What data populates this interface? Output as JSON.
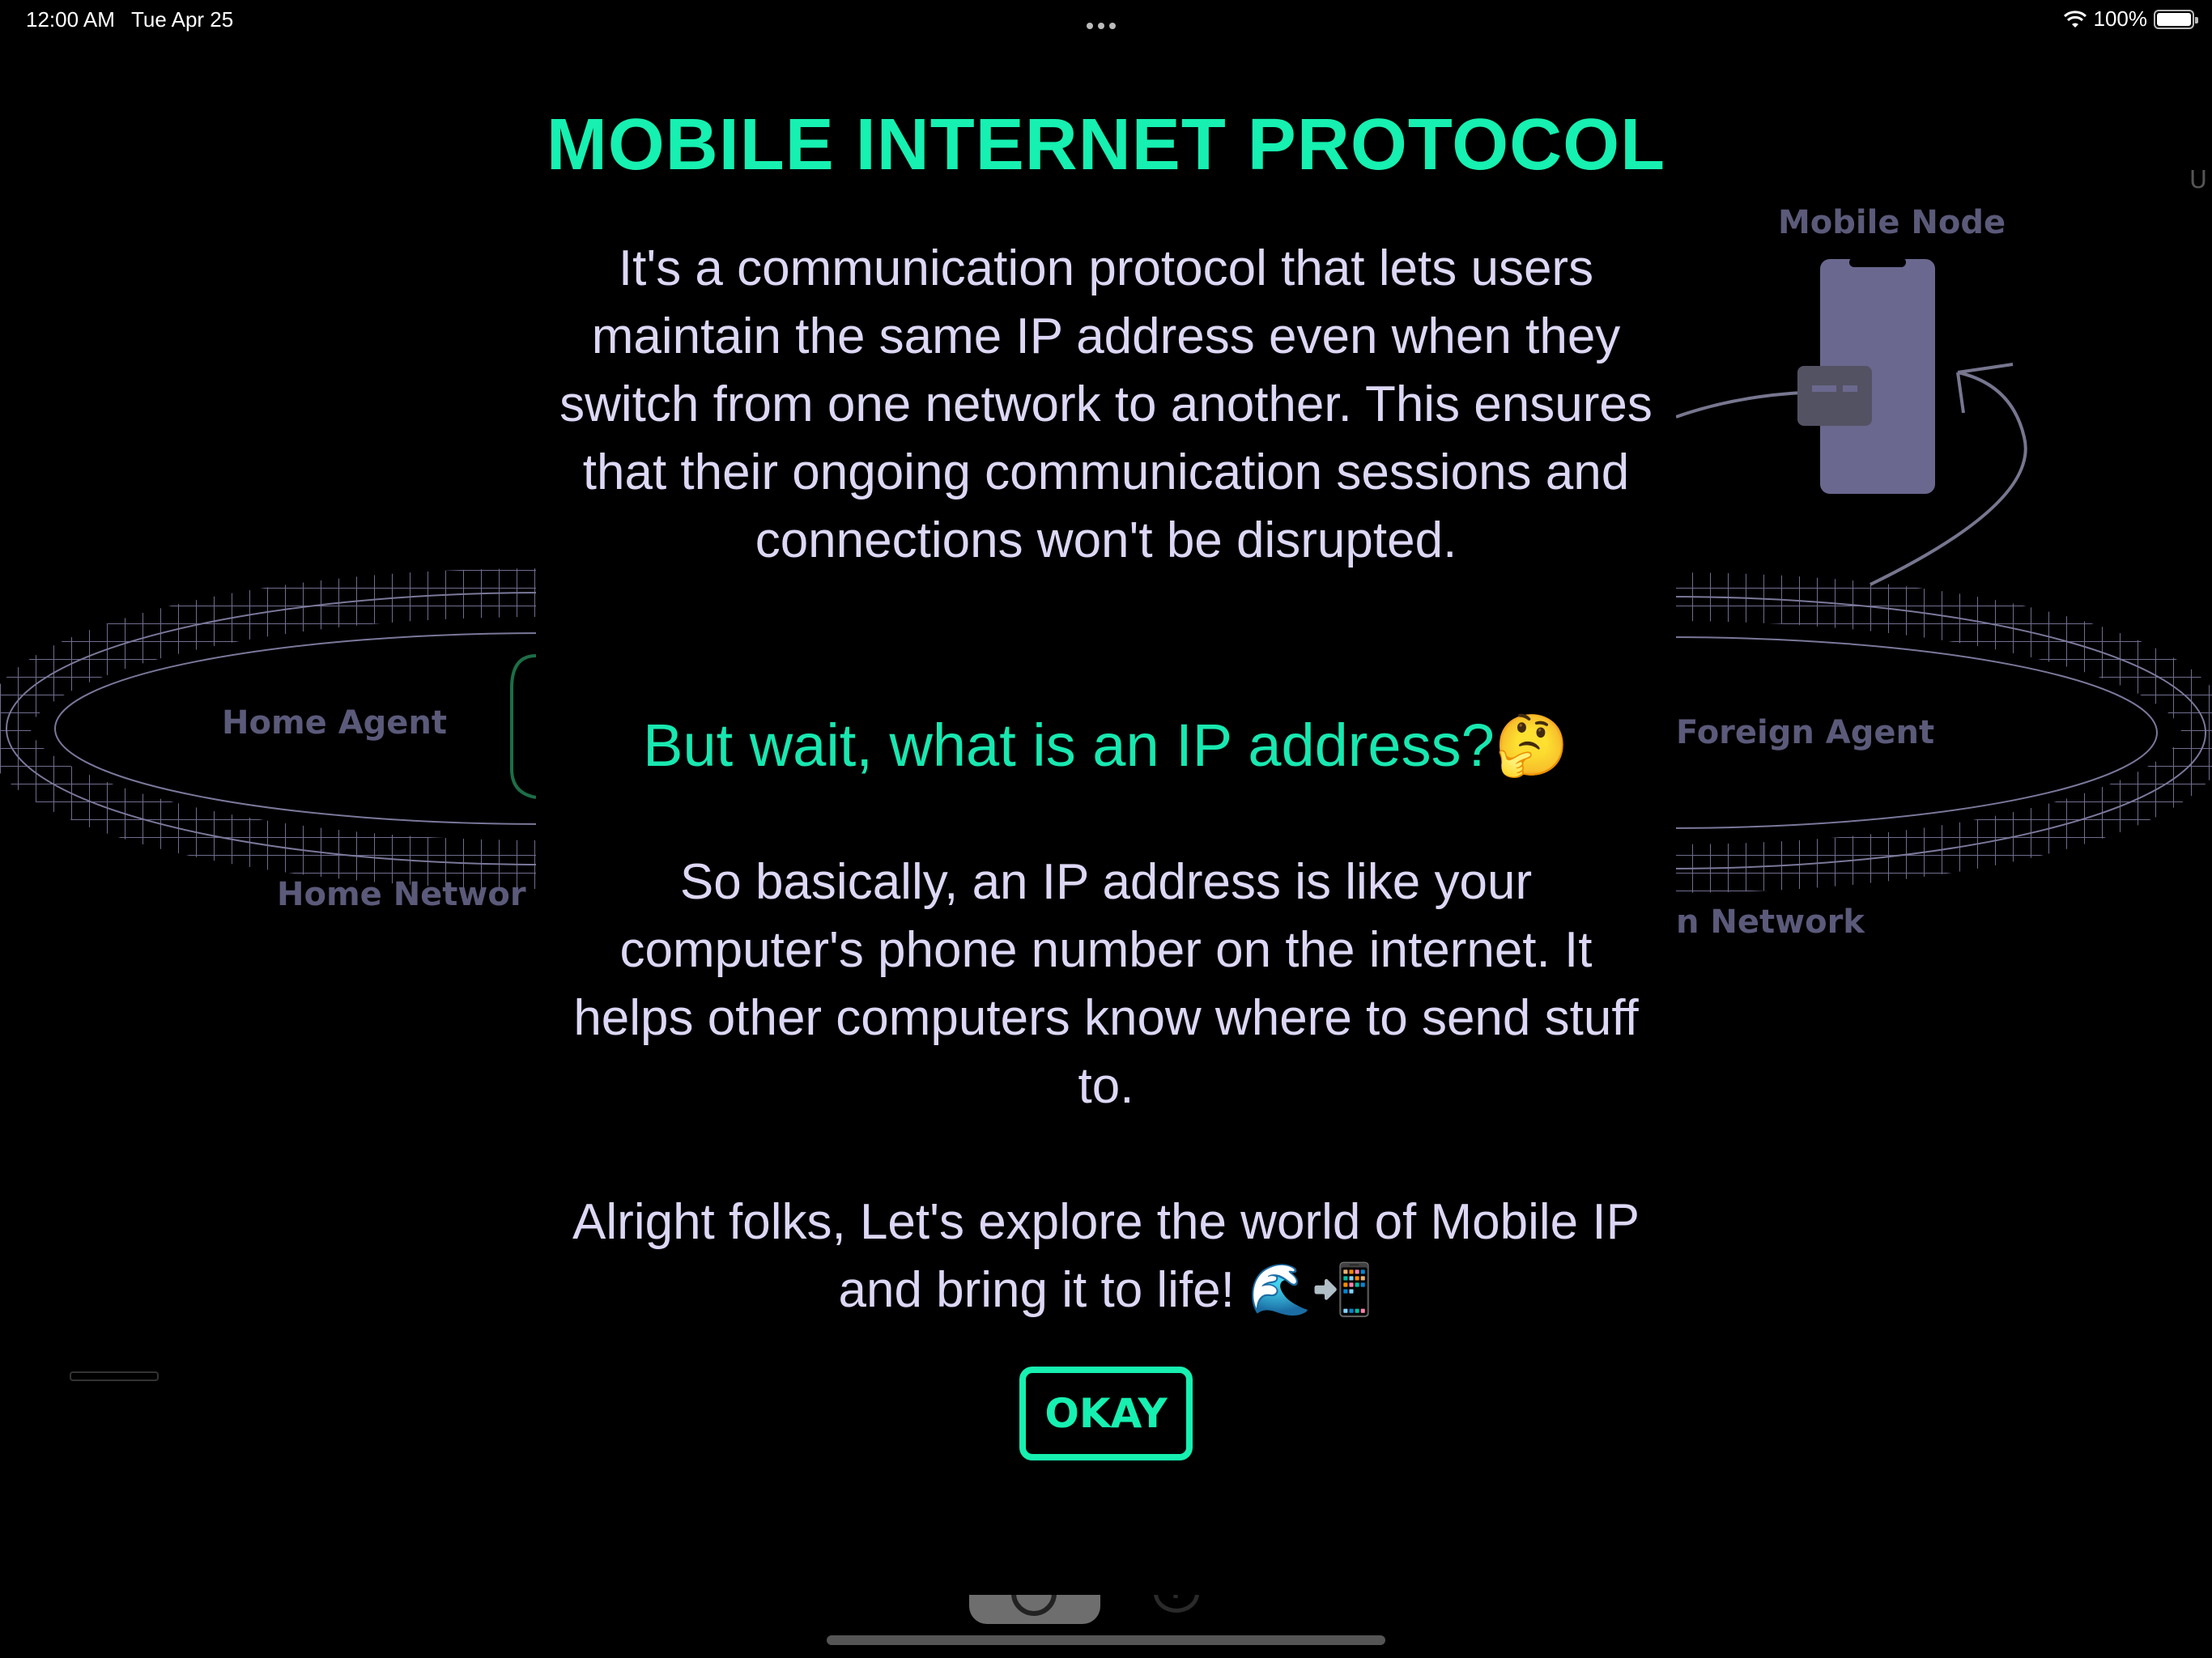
{
  "status_bar": {
    "time": "12:00 AM",
    "date": "Tue Apr 25",
    "battery_percent": "100%",
    "battery_level": 1.0
  },
  "background": {
    "home_agent_label": "Home Agent",
    "home_network_label": "Home Networ",
    "foreign_agent_label": "Foreign Agent",
    "foreign_network_label": "n Network",
    "mobile_node_label": "Mobile Node",
    "edge_char": "U"
  },
  "modal": {
    "title": "MOBILE INTERNET PROTOCOL",
    "intro": "It's a communication protocol that lets users maintain the same IP address even when they switch from one network to another. This ensures that their ongoing communication sessions and connections won't be disrupted.",
    "question": "But wait, what is an IP address?🤔",
    "explanation": "So basically, an IP address is like your computer's phone number on the internet. It helps other computers know where to send stuff to.",
    "call_to_action": "Alright folks, Let's explore the world of Mobile IP and bring it to life! 🌊📲",
    "okay_label": "OKAY"
  },
  "tabbar": {
    "help_icon_glyph": "?"
  },
  "colors": {
    "accent": "#16f0b0",
    "text": "#ddd7f5",
    "background": "#000000",
    "dim_label": "#5b5a7a"
  },
  "icons": [
    "wifi-icon",
    "battery-icon",
    "more-dots-icon",
    "home-tab-icon",
    "help-tab-icon",
    "phone-icon",
    "arrow-icon"
  ]
}
